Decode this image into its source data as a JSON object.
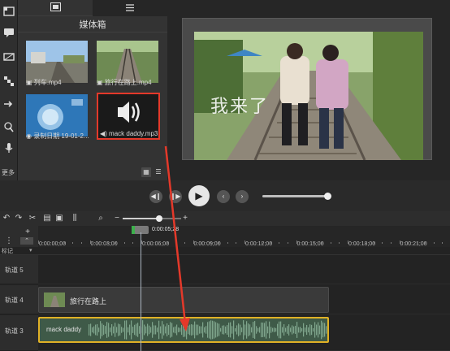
{
  "media_bin": {
    "title": "媒体箱",
    "tabs": [
      {
        "icon": "film-icon"
      },
      {
        "icon": "list-icon"
      }
    ],
    "items": [
      {
        "name": "列车.mp4",
        "type": "video"
      },
      {
        "name": "旅行在路上.mp4",
        "type": "video"
      },
      {
        "name": "录制日期 19-01-2...",
        "type": "recording"
      },
      {
        "name": "mack daddy.mp3",
        "type": "audio",
        "selected": true
      }
    ],
    "more_label": "更多"
  },
  "preview": {
    "overlay_text": "我来了"
  },
  "timeline": {
    "playhead_time": "0:00:05;28",
    "ruler_labels": [
      "0:00:00;00",
      "0:00:03;00",
      "0:00:06;00",
      "0:00:09;00",
      "0:00:12;00",
      "0:00:15;00",
      "0:00:18;00",
      "0:00:21;00"
    ],
    "markers_label": "标记",
    "tracks": [
      {
        "name": "轨道 5"
      },
      {
        "name": "轨道 4",
        "clip": "旅行在路上"
      },
      {
        "name": "轨道 3",
        "clip": "mack daddy"
      }
    ]
  },
  "colors": {
    "selection": "#e4392a",
    "audio_clip_border": "#e0b126",
    "audio_clip_bg": "#3f5a48",
    "arrow": "#e4392a"
  },
  "progress": {
    "playback_fraction": 0.98,
    "zoom_fraction": 0.62
  }
}
